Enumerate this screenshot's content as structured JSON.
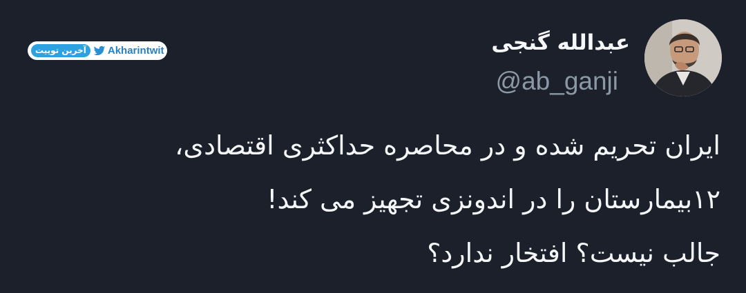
{
  "tweet": {
    "author": {
      "display_name": "عبدالله گنجی",
      "handle": "@ab_ganji",
      "avatar_icon": "profile-photo"
    },
    "body_lines": [
      "ایران تحریم شده و در محاصره حداکثری اقتصادی،",
      "۱۲بیمارستان را در اندونزی تجهیز می کند!",
      "جالب نیست؟ افتخار ندارد؟"
    ]
  },
  "watermark": {
    "persian_label": "آخرین توییت",
    "latin_label": "Akharintwit",
    "icon": "bird-icon",
    "accent_color": "#2ea1e0"
  },
  "theme": {
    "background": "#1c202b",
    "text_color": "#f4f6f8",
    "handle_color": "#8b98a5"
  }
}
